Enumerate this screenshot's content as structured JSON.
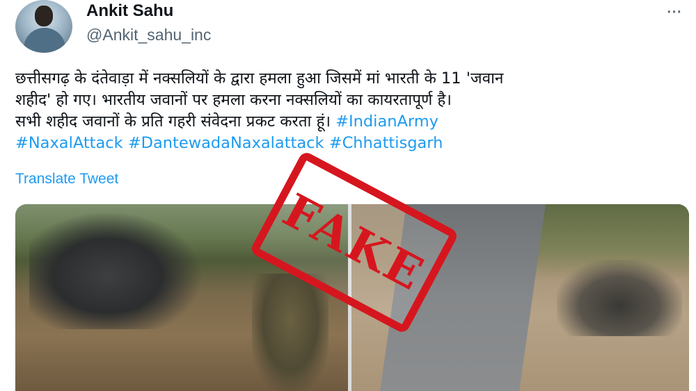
{
  "tweet": {
    "author": {
      "name": "Ankit Sahu",
      "handle": "@Ankit_sahu_inc"
    },
    "more_label": "···",
    "text_lines": [
      "छत्तीसगढ़ के दंतेवाड़ा में नक्सलियों के द्वारा हमला हुआ जिसमें मां भारती के 11 'जवान",
      "शहीद' हो गए। भारतीय जवानों पर हमला करना नक्सलियों का कायरतापूर्ण  है।",
      "सभी शहीद जवानों के प्रति गहरी संवेदना प्रकट करता हूं।"
    ],
    "hashtags": [
      "#IndianArmy",
      "#NaxalAttack",
      "#DantewadaNaxalattack",
      "#Chhattisgarh"
    ],
    "translate_label": "Translate Tweet"
  },
  "overlay": {
    "stamp_text": "FAKE",
    "stamp_color": "#d6161e"
  },
  "colors": {
    "link": "#1d9bf0",
    "secondary_text": "#536471"
  }
}
